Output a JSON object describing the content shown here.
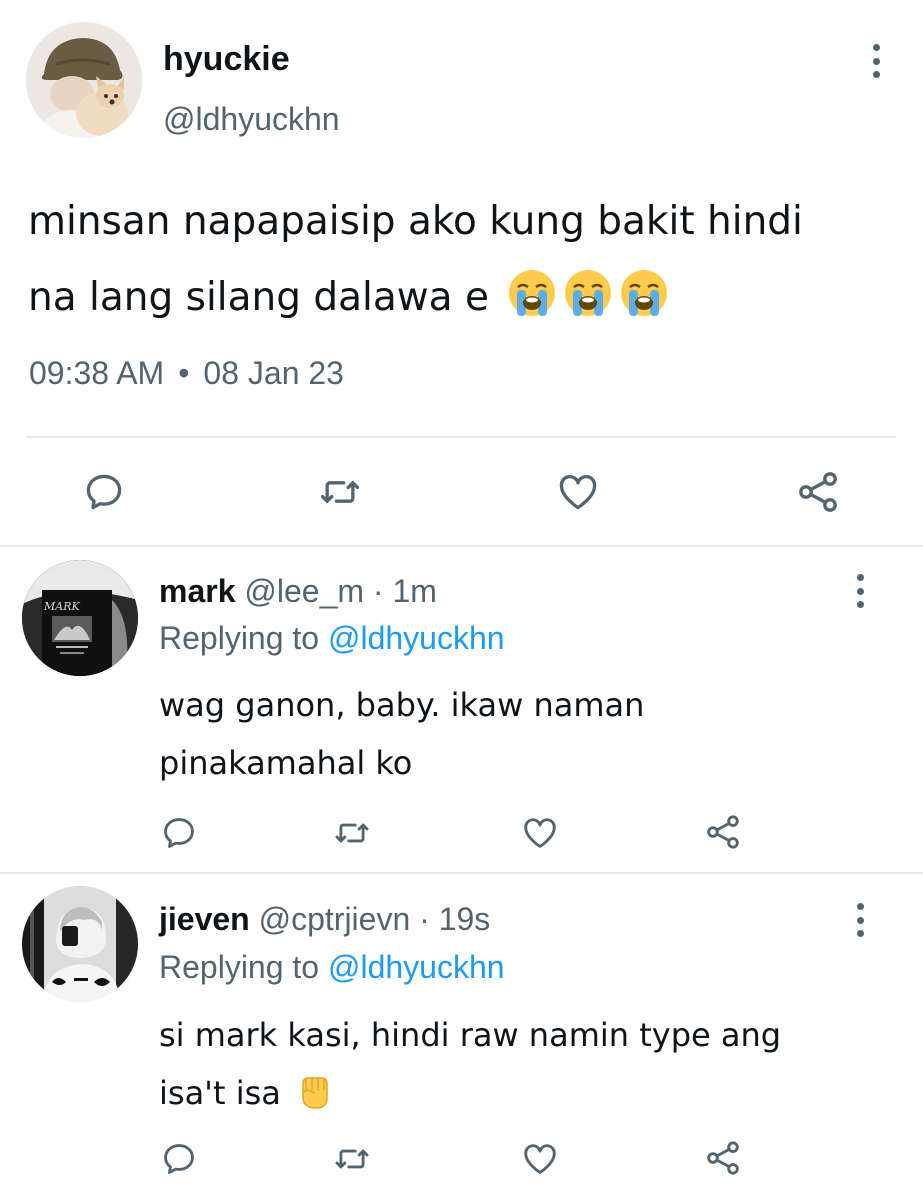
{
  "tweet": {
    "name": "hyuckie",
    "handle": "@ldhyuckhn",
    "text_line1": "minsan napapaisip ako kung bakit hindi",
    "text_line2": "na lang silang dalawa e",
    "emoji": "loudly-crying-face x3",
    "time": "09:38 AM",
    "separator": "•",
    "date": "08 Jan 23"
  },
  "replies": [
    {
      "name": "mark",
      "handle": "@lee_m",
      "time_sep": "·",
      "time": "1m",
      "replying_prefix": "Replying to ",
      "replying_to": "@ldhyuckhn",
      "text_line1": "wag ganon, baby. ikaw naman",
      "text_line2": "pinakamahal ko",
      "avatar_text": "MARK"
    },
    {
      "name": "jieven",
      "handle": "@cptrjievn",
      "time_sep": "·",
      "time": "19s",
      "replying_prefix": "Replying to ",
      "replying_to": "@ldhyuckhn",
      "text_line1": "si mark kasi, hindi raw namin type ang",
      "text_line2": "isa't isa",
      "emoji": "raised-fist"
    }
  ],
  "icons": {
    "reply": "speech-bubble-icon",
    "retweet": "retweet-icon",
    "like": "heart-icon",
    "share": "share-icon",
    "more": "kebab-icon"
  },
  "colors": {
    "text": "#0f1419",
    "secondary": "#536471",
    "accent": "#1d9bf0",
    "divider": "#e6e9eb"
  }
}
